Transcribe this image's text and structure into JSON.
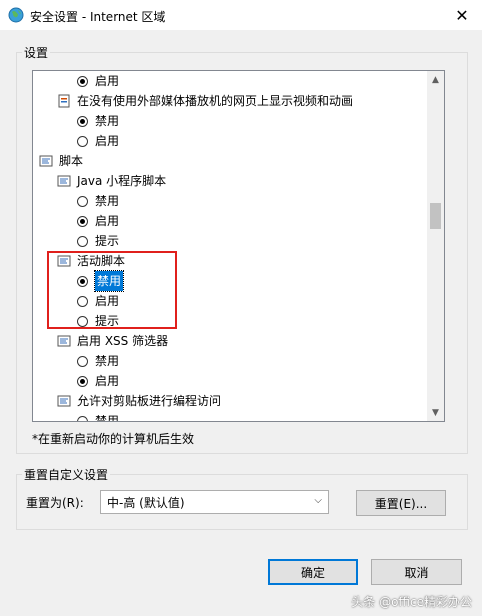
{
  "window": {
    "title": "安全设置 - Internet 区域",
    "close_glyph": "✕"
  },
  "settings_group": {
    "label": "设置"
  },
  "settings_list": [
    {
      "kind": "option",
      "label": "启用",
      "checked": true
    },
    {
      "kind": "item",
      "label": "在没有使用外部媒体播放机的网页上显示视频和动画"
    },
    {
      "kind": "option",
      "label": "禁用",
      "checked": true
    },
    {
      "kind": "option",
      "label": "启用",
      "checked": false
    },
    {
      "kind": "category",
      "label": "脚本"
    },
    {
      "kind": "item",
      "label": "Java 小程序脚本"
    },
    {
      "kind": "option",
      "label": "禁用",
      "checked": false
    },
    {
      "kind": "option",
      "label": "启用",
      "checked": true
    },
    {
      "kind": "option",
      "label": "提示",
      "checked": false
    },
    {
      "kind": "item",
      "label": "活动脚本"
    },
    {
      "kind": "option",
      "label": "禁用",
      "checked": true,
      "selected": true
    },
    {
      "kind": "option",
      "label": "启用",
      "checked": false
    },
    {
      "kind": "option",
      "label": "提示",
      "checked": false
    },
    {
      "kind": "item",
      "label": "启用 XSS 筛选器"
    },
    {
      "kind": "option",
      "label": "禁用",
      "checked": false
    },
    {
      "kind": "option",
      "label": "启用",
      "checked": true
    },
    {
      "kind": "item",
      "label": "允许对剪贴板进行编程访问"
    },
    {
      "kind": "option",
      "label": "禁用",
      "checked": false
    }
  ],
  "restart_note": "*在重新启动你的计算机后生效",
  "reset_group": {
    "label": "重置自定义设置",
    "reset_to_label": "重置为(R):",
    "selected_level": "中-高 (默认值)",
    "reset_button": "重置(E)..."
  },
  "footer": {
    "ok_button": "确定",
    "cancel_button": "取消"
  },
  "watermark": "头条 @office精彩办公",
  "colors": {
    "accent": "#0078d7",
    "highlight_border": "#e0201c"
  }
}
